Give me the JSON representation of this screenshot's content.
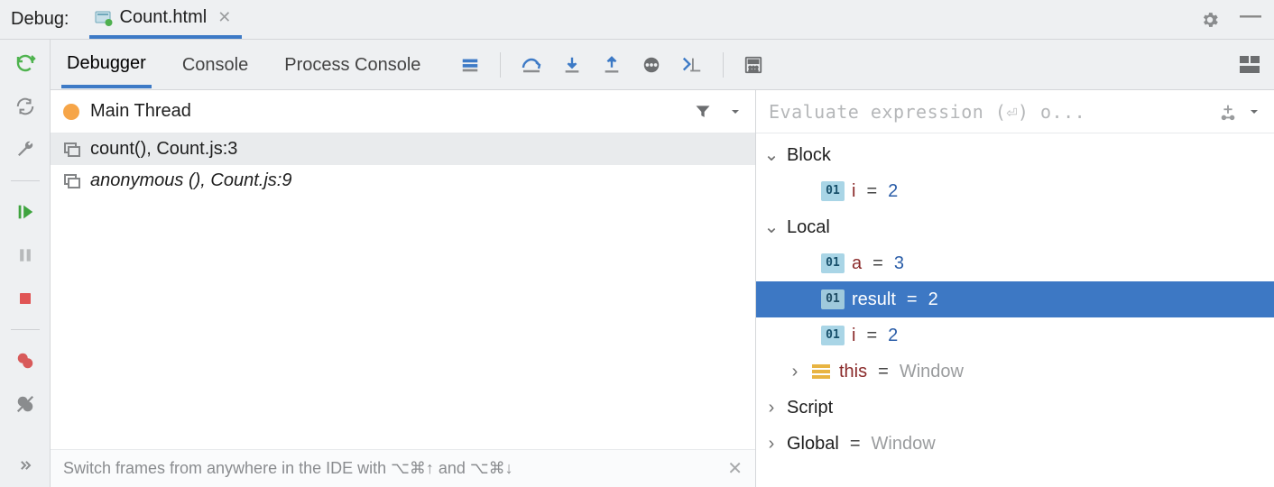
{
  "titlebar": {
    "label": "Debug:",
    "file_tab": "Count.html"
  },
  "tabs": {
    "debugger": "Debugger",
    "console": "Console",
    "process_console": "Process Console"
  },
  "frames": {
    "thread": "Main Thread",
    "items": [
      {
        "label": "count(), Count.js:3",
        "italic": false
      },
      {
        "label": "anonymous (), Count.js:9",
        "italic": true
      }
    ],
    "tip": "Switch frames from anywhere in the IDE with ⌥⌘↑ and ⌥⌘↓"
  },
  "vars": {
    "placeholder": "Evaluate expression (⏎) o...",
    "tree": {
      "block": {
        "label": "Block",
        "i": {
          "name": "i",
          "value": "2"
        }
      },
      "local": {
        "label": "Local",
        "a": {
          "name": "a",
          "value": "3"
        },
        "result": {
          "name": "result",
          "value": "2"
        },
        "i": {
          "name": "i",
          "value": "2"
        },
        "this": {
          "name": "this",
          "value": "Window"
        }
      },
      "script": {
        "label": "Script"
      },
      "global": {
        "label": "Global",
        "value": "Window"
      }
    }
  }
}
